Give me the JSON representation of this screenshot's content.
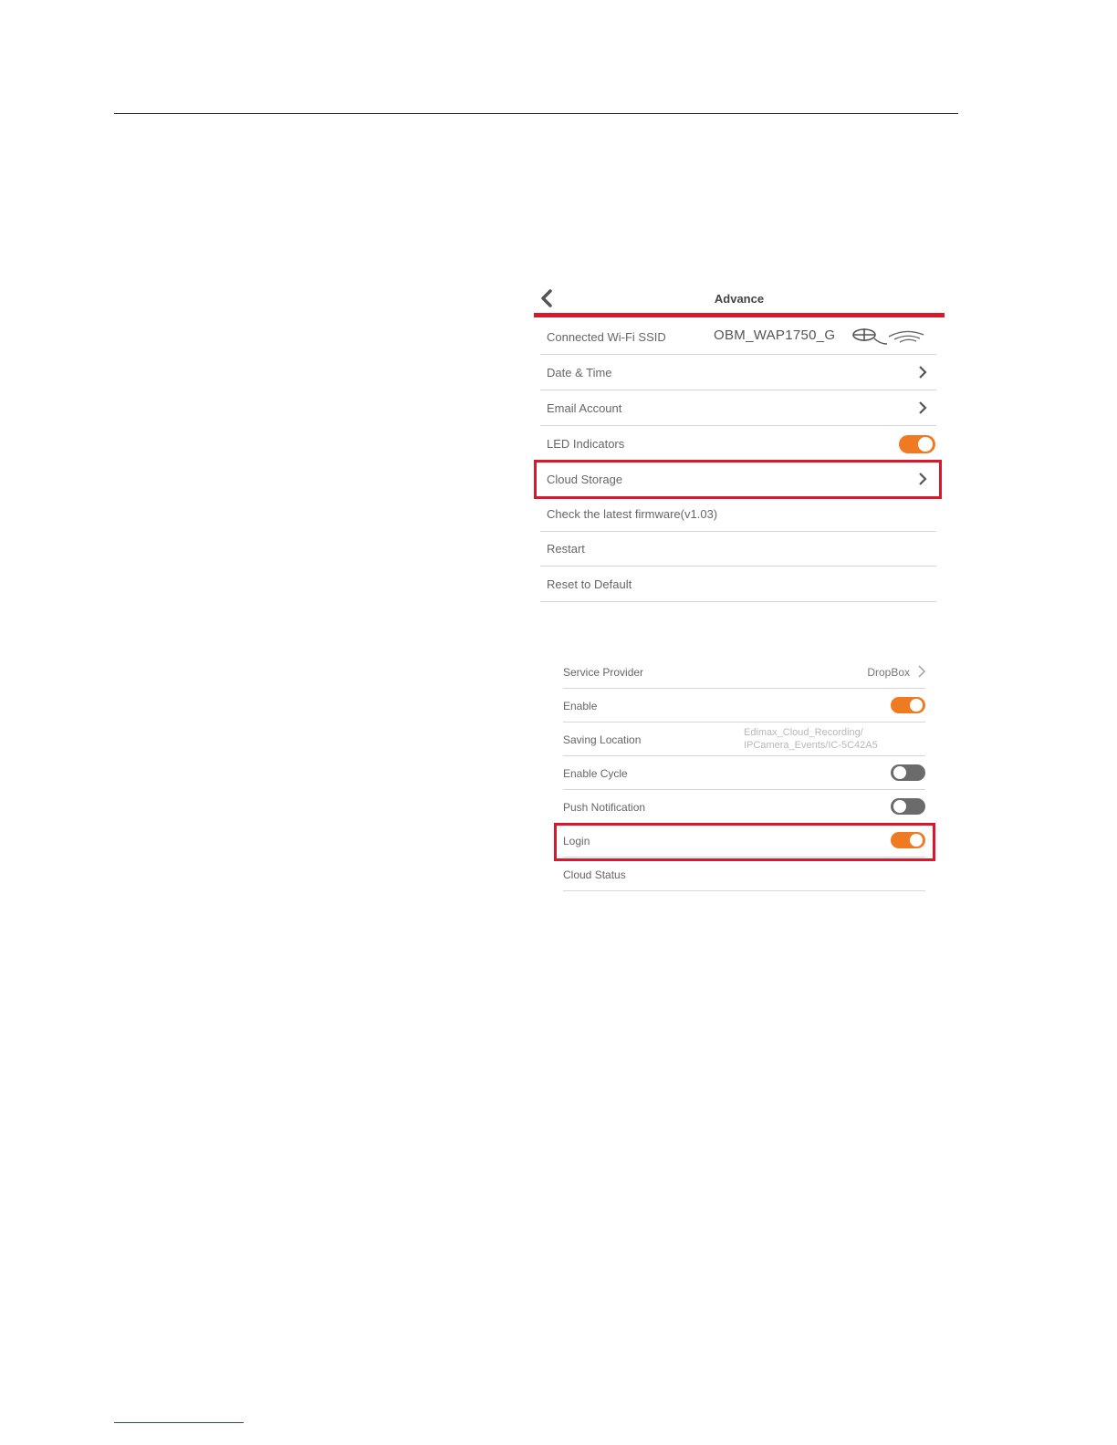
{
  "advance": {
    "title": "Advance",
    "rows": [
      {
        "label": "Connected Wi-Fi SSID",
        "value": "OBM_WAP1750_G"
      },
      {
        "label": "Date & Time"
      },
      {
        "label": "Email Account"
      },
      {
        "label": "LED Indicators",
        "toggle": "on"
      },
      {
        "label": "Cloud Storage",
        "highlighted": true
      },
      {
        "label": "Check the latest firmware(v1.03)"
      },
      {
        "label": "Restart"
      },
      {
        "label": "Reset to Default"
      }
    ]
  },
  "cloud": {
    "rows": [
      {
        "label": "Service Provider",
        "value": "DropBox"
      },
      {
        "label": "Enable",
        "toggle": "on"
      },
      {
        "label": "Saving Location",
        "value_line1": "Edimax_Cloud_Recording/",
        "value_line2": "IPCamera_Events/IC-5C42A5"
      },
      {
        "label": "Enable Cycle",
        "toggle": "off"
      },
      {
        "label": "Push Notification",
        "toggle": "off"
      },
      {
        "label": "Login",
        "toggle": "on",
        "highlighted": true
      },
      {
        "label": "Cloud Status"
      }
    ]
  },
  "colors": {
    "accent": "#d9192a",
    "toggle_on": "#f07a22",
    "toggle_off": "#6b6b6b"
  }
}
